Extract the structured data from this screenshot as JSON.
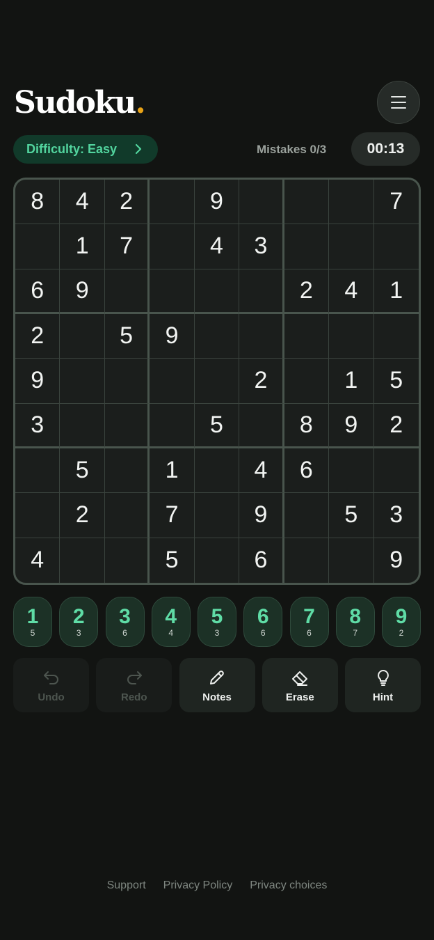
{
  "header": {
    "logo": "Sudoku",
    "logo_dot": "."
  },
  "difficulty": {
    "label": "Difficulty: Easy"
  },
  "status": {
    "mistakes": "Mistakes 0/3",
    "timer": "00:13"
  },
  "board": {
    "rows": [
      [
        "8",
        "4",
        "2",
        "",
        "9",
        "",
        "",
        "",
        "7"
      ],
      [
        "",
        "1",
        "7",
        "",
        "4",
        "3",
        "",
        "",
        ""
      ],
      [
        "6",
        "9",
        "",
        "",
        "",
        "",
        "2",
        "4",
        "1"
      ],
      [
        "2",
        "",
        "5",
        "9",
        "",
        "",
        "",
        "",
        ""
      ],
      [
        "9",
        "",
        "",
        "",
        "",
        "2",
        "",
        "1",
        "5"
      ],
      [
        "3",
        "",
        "",
        "",
        "5",
        "",
        "8",
        "9",
        "2"
      ],
      [
        "",
        "5",
        "",
        "1",
        "",
        "4",
        "6",
        "",
        ""
      ],
      [
        "",
        "2",
        "",
        "7",
        "",
        "9",
        "",
        "5",
        "3"
      ],
      [
        "4",
        "",
        "",
        "5",
        "",
        "6",
        "",
        "",
        "9"
      ]
    ]
  },
  "numpad": [
    {
      "digit": "1",
      "remaining": "5"
    },
    {
      "digit": "2",
      "remaining": "3"
    },
    {
      "digit": "3",
      "remaining": "6"
    },
    {
      "digit": "4",
      "remaining": "4"
    },
    {
      "digit": "5",
      "remaining": "3"
    },
    {
      "digit": "6",
      "remaining": "6"
    },
    {
      "digit": "7",
      "remaining": "6"
    },
    {
      "digit": "8",
      "remaining": "7"
    },
    {
      "digit": "9",
      "remaining": "2"
    }
  ],
  "actions": [
    {
      "label": "Undo",
      "icon": "undo-icon",
      "enabled": false
    },
    {
      "label": "Redo",
      "icon": "redo-icon",
      "enabled": false
    },
    {
      "label": "Notes",
      "icon": "pencil-icon",
      "enabled": true
    },
    {
      "label": "Erase",
      "icon": "eraser-icon",
      "enabled": true
    },
    {
      "label": "Hint",
      "icon": "lightbulb-icon",
      "enabled": true
    }
  ],
  "footer": {
    "support": "Support",
    "privacy_policy": "Privacy Policy",
    "privacy_choices": "Privacy choices"
  },
  "colors": {
    "accent": "#52d49e",
    "logo_dot": "#e8a317",
    "background": "#121412"
  }
}
